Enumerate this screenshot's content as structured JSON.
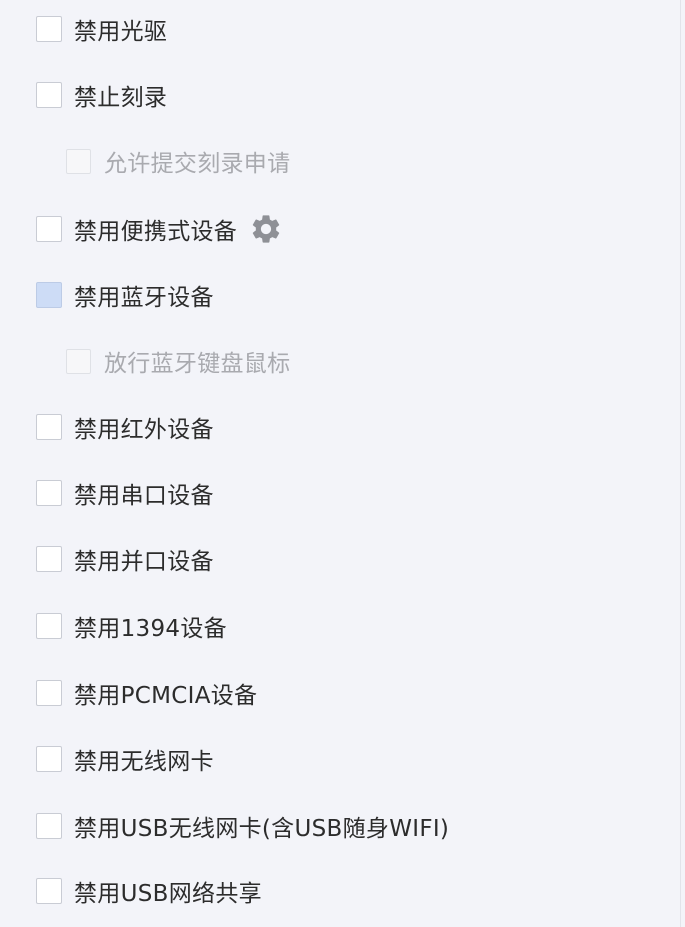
{
  "options": [
    {
      "label": "禁用光驱"
    },
    {
      "label": "禁止刻录"
    },
    {
      "label": "允许提交刻录申请"
    },
    {
      "label": "禁用便携式设备"
    },
    {
      "label": "禁用蓝牙设备"
    },
    {
      "label": "放行蓝牙键盘鼠标"
    },
    {
      "label": "禁用红外设备"
    },
    {
      "label": "禁用串口设备"
    },
    {
      "label": "禁用并口设备"
    },
    {
      "label": "禁用1394设备"
    },
    {
      "label": "禁用PCMCIA设备"
    },
    {
      "label": "禁用无线网卡"
    },
    {
      "label": "禁用USB无线网卡(含USB随身WIFI)"
    },
    {
      "label": "禁用USB网络共享"
    }
  ],
  "icons": {
    "portable_settings": "gear-icon"
  },
  "colors": {
    "background": "#f3f4f9",
    "checkbox_hover": "#cddcf6",
    "text": "#2c2c2c",
    "disabled_text": "#a9aaaf",
    "gear": "#8e9096"
  }
}
